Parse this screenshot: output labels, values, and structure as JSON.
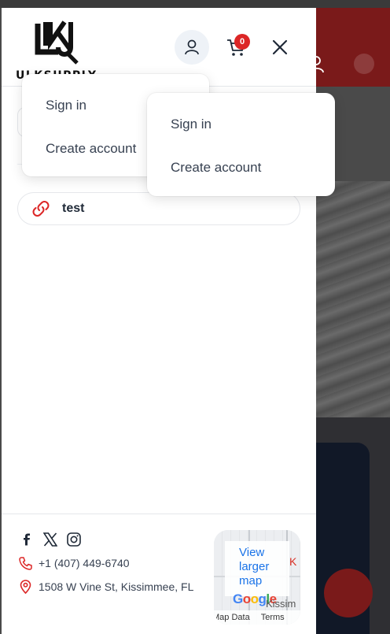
{
  "brand": {
    "logo_text": "ULKSUPPLY"
  },
  "header": {
    "cart_count": "0"
  },
  "account_menu_back": {
    "sign_in": "Sign in",
    "create_account": "Create account"
  },
  "account_menu_front": {
    "sign_in": "Sign in",
    "create_account": "Create account"
  },
  "links": [
    {
      "label": "test"
    }
  ],
  "footer": {
    "phone": "+1 (407) 449-6740",
    "address": "1508 W Vine St, Kissimmee, FL"
  },
  "map": {
    "view_larger": "View larger map",
    "google": [
      "G",
      "o",
      "o",
      "g",
      "l",
      "e"
    ],
    "place_text": "Kissim",
    "place_edge": "K",
    "map_data": "Map Data",
    "terms": "Terms"
  },
  "colors": {
    "accent_red": "#dc2626",
    "link_blue": "#1a73e8"
  }
}
